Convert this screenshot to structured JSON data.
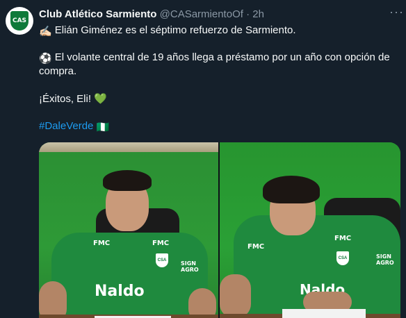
{
  "account": {
    "name": "Club Atlético Sarmiento",
    "handle": "@CASarmientoOf",
    "separator": "·",
    "time": "2h",
    "avatar_text": "CAS"
  },
  "tweet": {
    "line1": "Elián Giménez es el séptimo refuerzo de Sarmiento.",
    "line2a": "El volante central de 19 años llega a préstamo por un año con opción de",
    "line2b": "compra.",
    "line3": "¡Éxitos, Eli! 💚",
    "hashtag": "#DaleVerde",
    "emoji1": "✍🏻",
    "emoji2": "⚽",
    "emoji3": "🇳🇬"
  },
  "media": {
    "left_photo": {
      "sponsor": "Naldo",
      "shirt_logo_left": "FMC",
      "shirt_logo_right": "FMC",
      "crest": "CSA",
      "sleeve": "SIGN AGRO"
    },
    "right_photo": {
      "sponsor": "Naldo",
      "shirt_logo_left": "FMC",
      "shirt_logo_right": "FMC",
      "crest": "CSA",
      "sleeve": "SIGN AGRO"
    }
  },
  "icons": {
    "more": "more-options-icon"
  }
}
